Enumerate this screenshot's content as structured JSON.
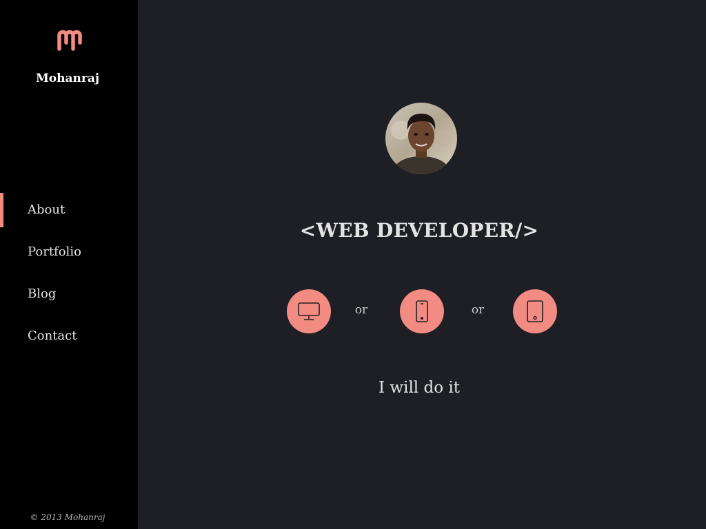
{
  "sidebar": {
    "logo_icon": "m-logo-icon",
    "brand_name": "Mohanraj",
    "nav": [
      {
        "label": "About",
        "active": true
      },
      {
        "label": "Portfolio",
        "active": false
      },
      {
        "label": "Blog",
        "active": false
      },
      {
        "label": "Contact",
        "active": false
      }
    ],
    "footer": "© 2013  Mohanraj"
  },
  "main": {
    "avatar": "profile-photo",
    "headline": "<WEB DEVELOPER/>",
    "devices": [
      {
        "icon": "desktop-icon"
      },
      {
        "icon": "smartphone-icon"
      },
      {
        "icon": "tablet-icon"
      }
    ],
    "separators": [
      "or",
      "or"
    ],
    "tagline": "I will do it"
  },
  "colors": {
    "accent": "#f28b82",
    "sidebar_bg": "#000000",
    "main_bg": "#1e1f25"
  }
}
